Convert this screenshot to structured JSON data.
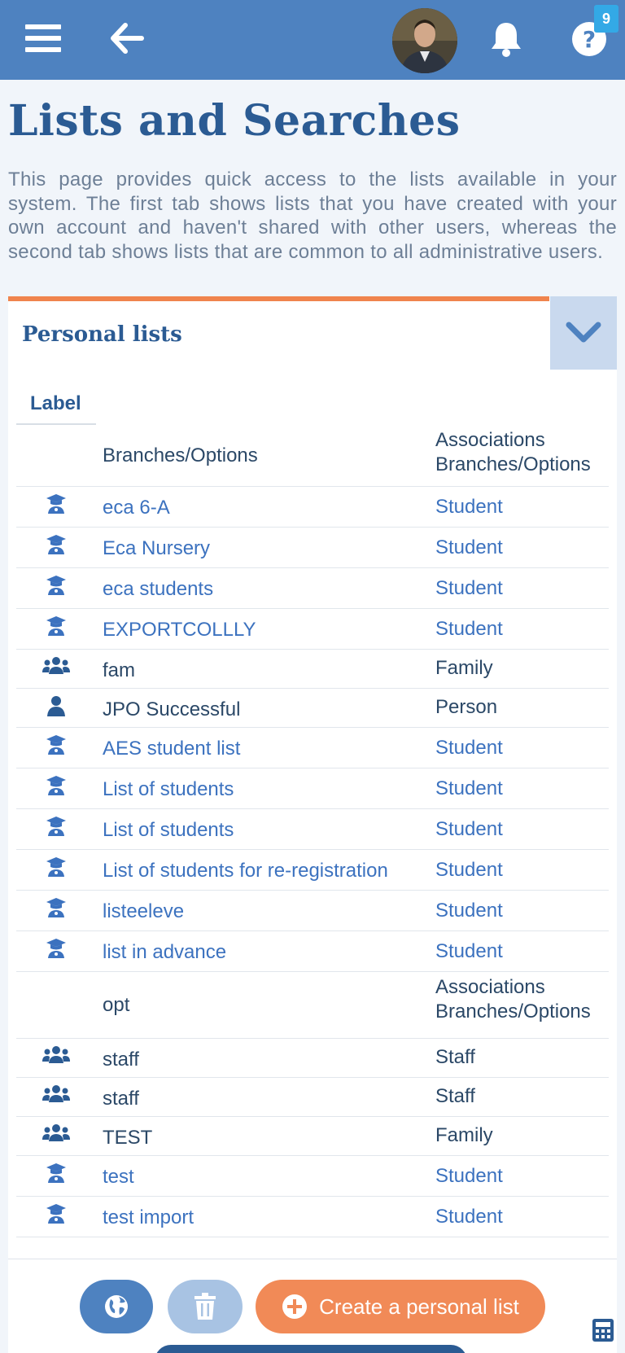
{
  "header": {
    "notification_count": "9",
    "icons": [
      "menu-icon",
      "back-arrow-icon",
      "avatar",
      "bell-icon",
      "help-icon"
    ],
    "color": "#4e82c0"
  },
  "page": {
    "title": "Lists and Searches",
    "description": "This page provides quick access to the lists available in your system. The first tab shows lists that you have created with your own account and haven't shared with other users, whereas the second tab shows lists that are common to all administrative users."
  },
  "personal_lists": {
    "title": "Personal lists",
    "column_label": "Label",
    "rows": [
      {
        "icon": "",
        "name": "Branches/Options",
        "assoc": "Associations Branches/Options",
        "link": false
      },
      {
        "icon": "student",
        "name": "eca 6-A",
        "assoc": "Student",
        "link": true
      },
      {
        "icon": "student",
        "name": "Eca Nursery",
        "assoc": "Student",
        "link": true
      },
      {
        "icon": "student",
        "name": "eca students",
        "assoc": "Student",
        "link": true
      },
      {
        "icon": "student",
        "name": "EXPORTCOLLLY",
        "assoc": "Student",
        "link": true
      },
      {
        "icon": "group",
        "name": "fam",
        "assoc": "Family",
        "link": false
      },
      {
        "icon": "person",
        "name": "JPO Successful",
        "assoc": "Person",
        "link": false
      },
      {
        "icon": "student",
        "name": "AES student list",
        "assoc": "Student",
        "link": true
      },
      {
        "icon": "student",
        "name": "List of students",
        "assoc": "Student",
        "link": true
      },
      {
        "icon": "student",
        "name": "List of students",
        "assoc": "Student",
        "link": true
      },
      {
        "icon": "student",
        "name": "List of students for re-registration",
        "assoc": "Student",
        "link": true
      },
      {
        "icon": "student",
        "name": "listeeleve",
        "assoc": "Student",
        "link": true
      },
      {
        "icon": "student",
        "name": "list in advance",
        "assoc": "Student",
        "link": true
      },
      {
        "icon": "",
        "name": "opt",
        "assoc": "Associations Branches/Options",
        "link": false
      },
      {
        "icon": "group",
        "name": "staff",
        "assoc": "Staff",
        "link": false
      },
      {
        "icon": "group",
        "name": "staff",
        "assoc": "Staff",
        "link": false
      },
      {
        "icon": "group",
        "name": "TEST",
        "assoc": "Family",
        "link": false
      },
      {
        "icon": "student",
        "name": "test",
        "assoc": "Student",
        "link": true
      },
      {
        "icon": "student",
        "name": "test import",
        "assoc": "Student",
        "link": true
      }
    ]
  },
  "actions": {
    "create_label": "Create a personal list",
    "accent": "#f18a57"
  }
}
